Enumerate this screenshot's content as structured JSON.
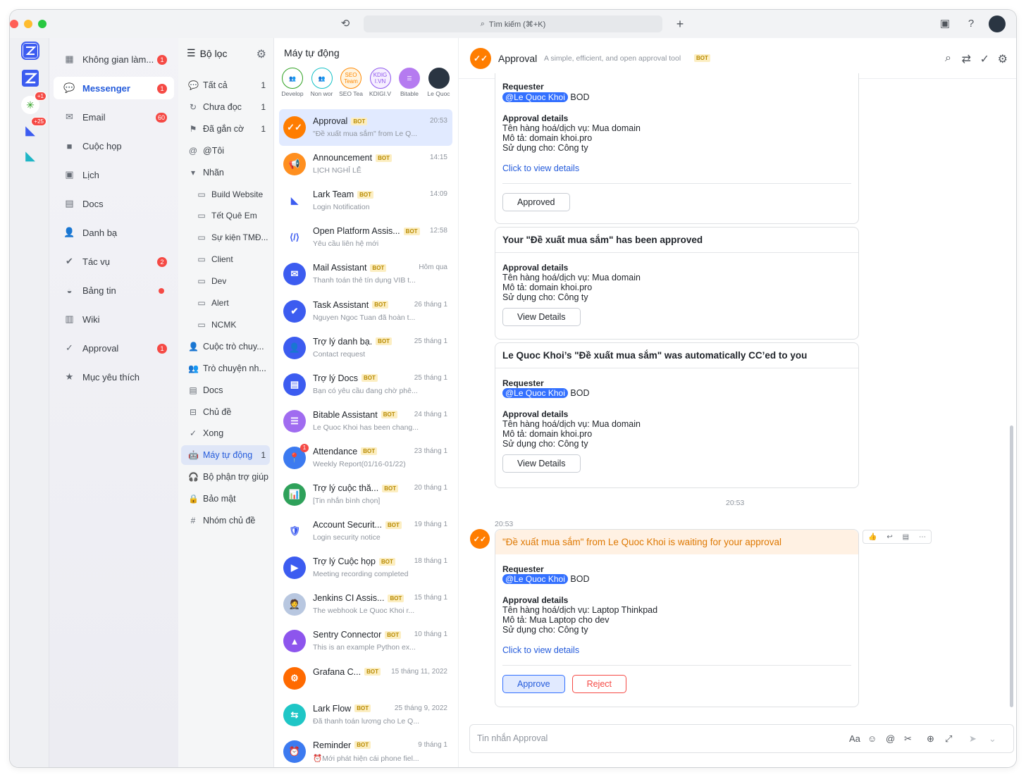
{
  "search": {
    "label": "Tìm kiếm (⌘+K)"
  },
  "nav": [
    {
      "label": "Không gian làm...",
      "badge": "1",
      "icon": "workspace-icon"
    },
    {
      "label": "Messenger",
      "badge": "1",
      "icon": "chat-icon"
    },
    {
      "label": "Email",
      "badge": "60",
      "icon": "mail-icon"
    },
    {
      "label": "Cuộc họp",
      "badge": "",
      "icon": "video-icon"
    },
    {
      "label": "Lịch",
      "badge": "",
      "icon": "calendar-icon"
    },
    {
      "label": "Docs",
      "badge": "",
      "icon": "docs-icon"
    },
    {
      "label": "Danh bạ",
      "badge": "",
      "icon": "contacts-icon"
    },
    {
      "label": "Tác vụ",
      "badge": "2",
      "icon": "task-icon"
    },
    {
      "label": "Bảng tin",
      "badge": "dot",
      "icon": "feed-icon"
    },
    {
      "label": "Wiki",
      "badge": "",
      "icon": "wiki-icon"
    },
    {
      "label": "Approval",
      "badge": "1",
      "icon": "approval-icon"
    },
    {
      "label": "Mục yêu thích",
      "badge": "",
      "icon": "star-icon"
    }
  ],
  "rail_badges": [
    "+1",
    "+25"
  ],
  "filters": {
    "title": "Bộ lọc",
    "items": [
      {
        "label": "Tất cả",
        "count": "1",
        "icon": "💬",
        "sub": false
      },
      {
        "label": "Chưa đọc",
        "count": "1",
        "icon": "↻",
        "sub": false
      },
      {
        "label": "Đã gắn cờ",
        "count": "1",
        "icon": "⚑",
        "sub": false
      },
      {
        "label": "@Tôi",
        "count": "",
        "icon": "@",
        "sub": false
      },
      {
        "label": "Nhãn",
        "count": "",
        "icon": "▾",
        "sub": false
      },
      {
        "label": "Build Website",
        "count": "",
        "icon": "▭",
        "sub": true
      },
      {
        "label": "Tết Quê Em",
        "count": "",
        "icon": "▭",
        "sub": true
      },
      {
        "label": "Sự kiện TMĐ...",
        "count": "",
        "icon": "▭",
        "sub": true
      },
      {
        "label": "Client",
        "count": "",
        "icon": "▭",
        "sub": true
      },
      {
        "label": "Dev",
        "count": "",
        "icon": "▭",
        "sub": true
      },
      {
        "label": "Alert",
        "count": "",
        "icon": "▭",
        "sub": true
      },
      {
        "label": "NCMK",
        "count": "",
        "icon": "▭",
        "sub": true
      },
      {
        "label": "Cuộc trò chuy...",
        "count": "",
        "icon": "👤",
        "sub": false
      },
      {
        "label": "Trò chuyện nh...",
        "count": "",
        "icon": "👥",
        "sub": false
      },
      {
        "label": "Docs",
        "count": "",
        "icon": "▤",
        "sub": false
      },
      {
        "label": "Chủ đề",
        "count": "",
        "icon": "⊟",
        "sub": false
      },
      {
        "label": "Xong",
        "count": "",
        "icon": "✓",
        "sub": false
      },
      {
        "label": "Máy tự động",
        "count": "1",
        "icon": "🤖",
        "sub": false
      },
      {
        "label": "Bộ phận trợ giúp",
        "count": "",
        "icon": "🎧",
        "sub": false
      },
      {
        "label": "Bảo mật",
        "count": "",
        "icon": "🔒",
        "sub": false
      },
      {
        "label": "Nhóm chủ đề",
        "count": "",
        "icon": "#",
        "sub": false
      }
    ]
  },
  "chats": {
    "title": "Máy tự động",
    "pins": [
      {
        "label": "Develop",
        "text": "👥",
        "color": "#ffffff",
        "border": "#2ea121"
      },
      {
        "label": "Non wor",
        "text": "👥",
        "color": "#ffffff",
        "border": "#14c0c6"
      },
      {
        "label": "SEO Tea",
        "text": "SEO Team",
        "color": "#fff4e0",
        "border": "#ff8800"
      },
      {
        "label": "KDIGI.V",
        "text": "KDIG I.VN",
        "color": "#f6efff",
        "border": "#8d55ed"
      },
      {
        "label": "Bitable",
        "text": "☰",
        "color": "#b57bf0",
        "border": "#b57bf0"
      },
      {
        "label": "Le Quoc",
        "text": "",
        "color": "#2a3542",
        "border": "#2a3542"
      }
    ],
    "items": [
      {
        "name": "Approval",
        "time": "20:53",
        "preview": "\"Đề xuất mua sắm\" from Le Q...",
        "color": "#ff7d00",
        "glyph": "✓✓",
        "badge": ""
      },
      {
        "name": "Announcement",
        "time": "14:15",
        "preview": "LỊCH NGHỈ LỄ",
        "color": "#ff8f1f",
        "glyph": "📢",
        "badge": ""
      },
      {
        "name": "Lark Team",
        "time": "14:09",
        "preview": "Login Notification",
        "color": "#ffffff",
        "glyph": "◣",
        "badge": ""
      },
      {
        "name": "Open Platform Assis...",
        "time": "12:58",
        "preview": "Yêu cầu liên hệ mới",
        "color": "#ffffff",
        "glyph": "⟨/⟩",
        "badge": ""
      },
      {
        "name": "Mail Assistant",
        "time": "Hôm qua",
        "preview": "Thanh toán thẻ tín dụng VIB t...",
        "color": "#3c5cf0",
        "glyph": "✉",
        "badge": ""
      },
      {
        "name": "Task Assistant",
        "time": "26 tháng 1",
        "preview": "Nguyen Ngoc Tuan đã hoàn t...",
        "color": "#3c5cf0",
        "glyph": "✔",
        "badge": ""
      },
      {
        "name": "Trợ lý danh bạ.",
        "time": "25 tháng 1",
        "preview": "Contact request",
        "color": "#3c5cf0",
        "glyph": "👤",
        "badge": ""
      },
      {
        "name": "Trợ lý Docs",
        "time": "25 tháng 1",
        "preview": "Bạn có yêu cầu đang chờ phê...",
        "color": "#3c5cf0",
        "glyph": "▤",
        "badge": ""
      },
      {
        "name": "Bitable Assistant",
        "time": "24 tháng 1",
        "preview": "Le Quoc Khoi has been chang...",
        "color": "#a06cf0",
        "glyph": "☰",
        "badge": ""
      },
      {
        "name": "Attendance",
        "time": "23 tháng 1",
        "preview": "Weekly Report(01/16-01/22)",
        "color": "#3c7af0",
        "glyph": "📍",
        "badge": "1"
      },
      {
        "name": "Trợ lý cuộc thă...",
        "time": "20 tháng 1",
        "preview": "[Tin nhắn bình chọn]",
        "color": "#2ea15a",
        "glyph": "📊",
        "badge": ""
      },
      {
        "name": "Account Securit...",
        "time": "19 tháng 1",
        "preview": "Login security notice",
        "color": "#ffffff",
        "glyph": "🛡",
        "badge": ""
      },
      {
        "name": "Trợ lý Cuộc họp",
        "time": "18 tháng 1",
        "preview": "Meeting recording completed",
        "color": "#3c5cf0",
        "glyph": "▶",
        "badge": ""
      },
      {
        "name": "Jenkins CI Assis...",
        "time": "15 tháng 1",
        "preview": "The webhook Le Quoc Khoi r...",
        "color": "#b8c7e0",
        "glyph": "🤵",
        "badge": ""
      },
      {
        "name": "Sentry Connector",
        "time": "10 tháng 1",
        "preview": "This is an example Python ex...",
        "color": "#8d55ed",
        "glyph": "▲",
        "badge": ""
      },
      {
        "name": "Grafana C...",
        "time": "15 tháng 11, 2022",
        "preview": "",
        "color": "#ff6a00",
        "glyph": "⚙",
        "badge": ""
      },
      {
        "name": "Lark Flow",
        "time": "25 tháng 9, 2022",
        "preview": "Đã thanh toán lương cho Le Q...",
        "color": "#1fc6c6",
        "glyph": "⇆",
        "badge": ""
      },
      {
        "name": "Reminder",
        "time": "9 tháng 1",
        "preview": "⏰Mới phát hiện cái phone fiel...",
        "color": "#3c7af0",
        "glyph": "⏰",
        "badge": ""
      }
    ]
  },
  "conv": {
    "title": "Approval",
    "subtitle": "A simple, efficient, and open approval tool",
    "bot": "BOT",
    "card1": {
      "requester_label": "Requester",
      "mention": "@Le Quoc Khoi",
      "dept": "BOD",
      "details_label": "Approval details",
      "l1": "Tên hàng hoá/dịch vụ: Mua domain",
      "l2": "Mô tả: domain khoi.pro",
      "l3": "Sử dụng cho: Công ty",
      "link": "Click to view details",
      "button": "Approved"
    },
    "card2": {
      "title": "Your \"Đề xuất mua sắm\" has been approved",
      "details_label": "Approval details",
      "l1": "Tên hàng hoá/dịch vụ: Mua domain",
      "l2": "Mô tả: domain khoi.pro",
      "l3": "Sử dụng cho: Công ty",
      "button": "View Details"
    },
    "card3": {
      "title": "Le Quoc Khoi’s \"Đề xuất mua sắm\" was automatically CC’ed to you",
      "requester_label": "Requester",
      "mention": "@Le Quoc Khoi",
      "dept": "BOD",
      "details_label": "Approval details",
      "l1": "Tên hàng hoá/dịch vụ: Mua domain",
      "l2": "Mô tả: domain khoi.pro",
      "l3": "Sử dụng cho: Công ty",
      "button": "View Details"
    },
    "time_divider": "20:53",
    "msg_time": "20:53",
    "card4": {
      "title": "\"Đề xuất mua sắm\" from Le Quoc Khoi is waiting for your approval",
      "requester_label": "Requester",
      "mention": "@Le Quoc Khoi",
      "dept": "BOD",
      "details_label": "Approval details",
      "l1": "Tên hàng hoá/dịch vụ: Laptop Thinkpad",
      "l2": "Mô tả: Mua Laptop cho dev",
      "l3": "Sử dụng cho: Công ty",
      "link": "Click to view details",
      "approve": "Approve",
      "reject": "Reject"
    },
    "composer_placeholder": "Tin nhắn Approval"
  }
}
